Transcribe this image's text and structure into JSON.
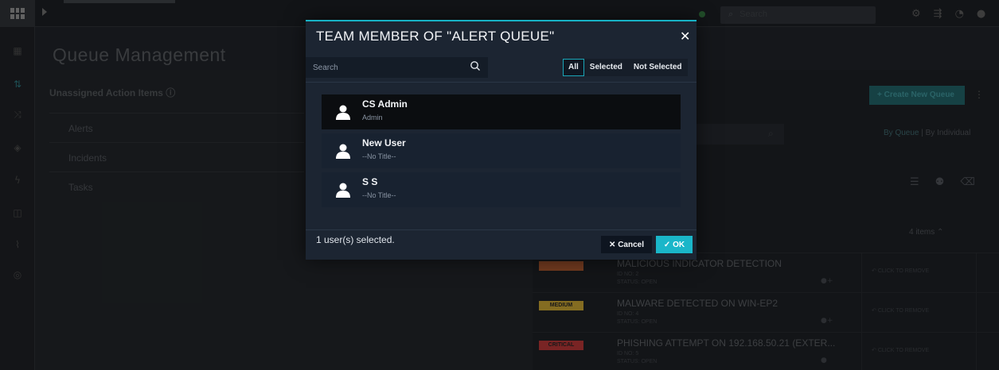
{
  "app": {
    "page_title": "Queue Management",
    "top_search_placeholder": "Search",
    "icons": {
      "logo": "grid-logo-icon",
      "settings": "gear-icon",
      "workflow": "workflow-icon",
      "notifications": "bell-icon",
      "profile": "user-icon"
    }
  },
  "sidebar": {
    "items": [
      {
        "icon": "dashboard-icon"
      },
      {
        "icon": "queue-icon",
        "active": true
      },
      {
        "icon": "shuffle-icon"
      },
      {
        "icon": "shield-icon"
      },
      {
        "icon": "bolt-icon"
      },
      {
        "icon": "module-icon"
      },
      {
        "icon": "chart-icon"
      },
      {
        "icon": "globe-icon"
      }
    ]
  },
  "left_panel": {
    "heading": "Unassigned Action Items",
    "info_icon": "info-icon",
    "rows": [
      {
        "label": "Alerts"
      },
      {
        "label": "Incidents"
      },
      {
        "label": "Tasks"
      }
    ]
  },
  "right_panel": {
    "create_button": "+ Create New Queue",
    "view_toggle": {
      "by_queue": "By Queue",
      "separator": " | ",
      "by_individual": "By Individual"
    },
    "items_count": "4 items",
    "alerts": [
      {
        "severity": "",
        "severity_color": "#a0522d",
        "title": "MALICIOUS INDICATOR DETECTION",
        "id": "ID NO: 2",
        "status": "STATUS: OPEN",
        "remove": "CLICK TO REMOVE"
      },
      {
        "severity": "MEDIUM",
        "severity_color": "#b8962e",
        "title": "MALWARE DETECTED ON WIN-EP2",
        "id": "ID NO: 4",
        "status": "STATUS: OPEN",
        "remove": "CLICK TO REMOVE"
      },
      {
        "severity": "CRITICAL",
        "severity_color": "#a83232",
        "title": "PHISHING ATTEMPT ON 192.168.50.21 (EXTER...",
        "id": "ID NO: 5",
        "status": "STATUS: OPEN",
        "remove": "CLICK TO REMOVE"
      }
    ]
  },
  "modal": {
    "title": "TEAM MEMBER OF \"ALERT QUEUE\"",
    "search_placeholder": "Search",
    "filters": [
      {
        "label": "All",
        "active": true
      },
      {
        "label": "Selected",
        "active": false
      },
      {
        "label": "Not Selected",
        "active": false
      }
    ],
    "users": [
      {
        "name": "CS Admin",
        "title": "Admin",
        "selected": true
      },
      {
        "name": "New User",
        "title": "--No Title--",
        "selected": false
      },
      {
        "name": "S S",
        "title": "--No Title--",
        "selected": false
      }
    ],
    "footer_status": "1 user(s) selected.",
    "cancel_label": "Cancel",
    "ok_label": "OK",
    "accent_color": "#1ab6c9"
  }
}
